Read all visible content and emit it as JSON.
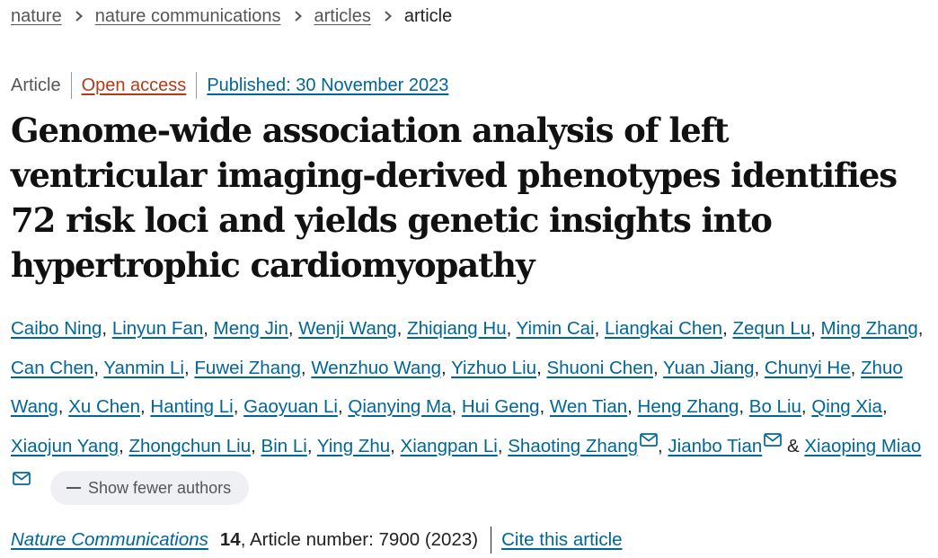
{
  "breadcrumb": {
    "items": [
      "nature",
      "nature communications",
      "articles"
    ],
    "current": "article"
  },
  "meta": {
    "article_type": "Article",
    "access": "Open access",
    "published": "Published: 30 November 2023"
  },
  "title": "Genome-wide association analysis of left ventricular imaging-derived phenotypes identifies 72 risk loci and yields genetic insights into hypertrophic cardiomyopathy",
  "authors": {
    "list": [
      "Caibo Ning",
      "Linyun Fan",
      "Meng Jin",
      "Wenji Wang",
      "Zhiqiang Hu",
      "Yimin Cai",
      "Liangkai Chen",
      "Zequn Lu",
      "Ming Zhang",
      "Can Chen",
      "Yanmin Li",
      "Fuwei Zhang",
      "Wenzhuo Wang",
      "Yizhuo Liu",
      "Shuoni Chen",
      "Yuan Jiang",
      "Chunyi He",
      "Zhuo Wang",
      "Xu Chen",
      "Hanting Li",
      "Gaoyuan Li",
      "Qianying Ma",
      "Hui Geng",
      "Wen Tian",
      "Heng Zhang",
      "Bo Liu",
      "Qing Xia",
      "Xiaojun Yang",
      "Zhongchun Liu",
      "Bin Li",
      "Ying Zhu",
      "Xiangpan Li",
      "Shaoting Zhang",
      "Jianbo Tian",
      "Xiaoping Miao"
    ],
    "corresponding": [
      "Shaoting Zhang",
      "Jianbo Tian",
      "Xiaoping Miao"
    ],
    "separator": ",",
    "final_joiner": "&",
    "toggle_label": "Show fewer authors"
  },
  "citation": {
    "journal": "Nature Communications",
    "volume": "14",
    "article_number": ", Article number: 7900 (2023)",
    "cite_label": "Cite this article"
  },
  "colors": {
    "link": "#006699",
    "open_access": "#b53a17",
    "text": "#222222",
    "muted": "#555555",
    "pill_bg": "#eef0f3"
  },
  "icons": {
    "breadcrumb_separator": "chevron-right-icon",
    "corresponding_author": "envelope-icon",
    "toggle": "minus-icon"
  }
}
